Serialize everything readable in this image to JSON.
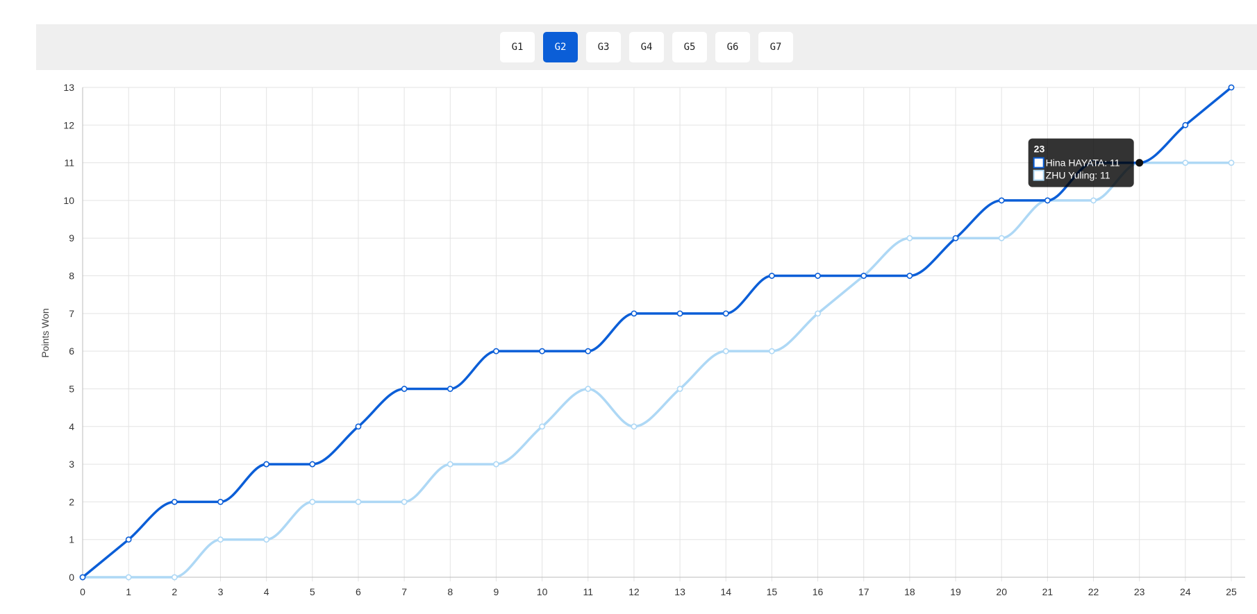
{
  "tabs": [
    {
      "label": "G1",
      "active": false
    },
    {
      "label": "G2",
      "active": true
    },
    {
      "label": "G3",
      "active": false
    },
    {
      "label": "G4",
      "active": false
    },
    {
      "label": "G5",
      "active": false
    },
    {
      "label": "G6",
      "active": false
    },
    {
      "label": "G7",
      "active": false
    }
  ],
  "chart_data": {
    "type": "line",
    "ylabel": "Points Won",
    "xlabel": "",
    "x": [
      0,
      1,
      2,
      3,
      4,
      5,
      6,
      7,
      8,
      9,
      10,
      11,
      12,
      13,
      14,
      15,
      16,
      17,
      18,
      19,
      20,
      21,
      22,
      23,
      24,
      25
    ],
    "xlim": [
      0,
      25
    ],
    "ylim": [
      0,
      13
    ],
    "grid": true,
    "series": [
      {
        "name": "Hina HAYATA",
        "color": "#0b5ed7",
        "values": [
          0,
          1,
          2,
          2,
          3,
          3,
          4,
          5,
          5,
          6,
          6,
          6,
          7,
          7,
          7,
          8,
          8,
          8,
          8,
          9,
          10,
          10,
          11,
          11,
          12,
          13
        ]
      },
      {
        "name": "ZHU Yuling",
        "color": "#aed8f5",
        "values": [
          0,
          0,
          0,
          1,
          1,
          2,
          2,
          2,
          3,
          3,
          4,
          5,
          4,
          5,
          6,
          6,
          7,
          8,
          9,
          9,
          9,
          10,
          10,
          11,
          11,
          11
        ]
      }
    ],
    "tooltip": {
      "title": "23",
      "lines": [
        "Hina HAYATA: 11",
        "ZHU Yuling: 11"
      ]
    }
  }
}
